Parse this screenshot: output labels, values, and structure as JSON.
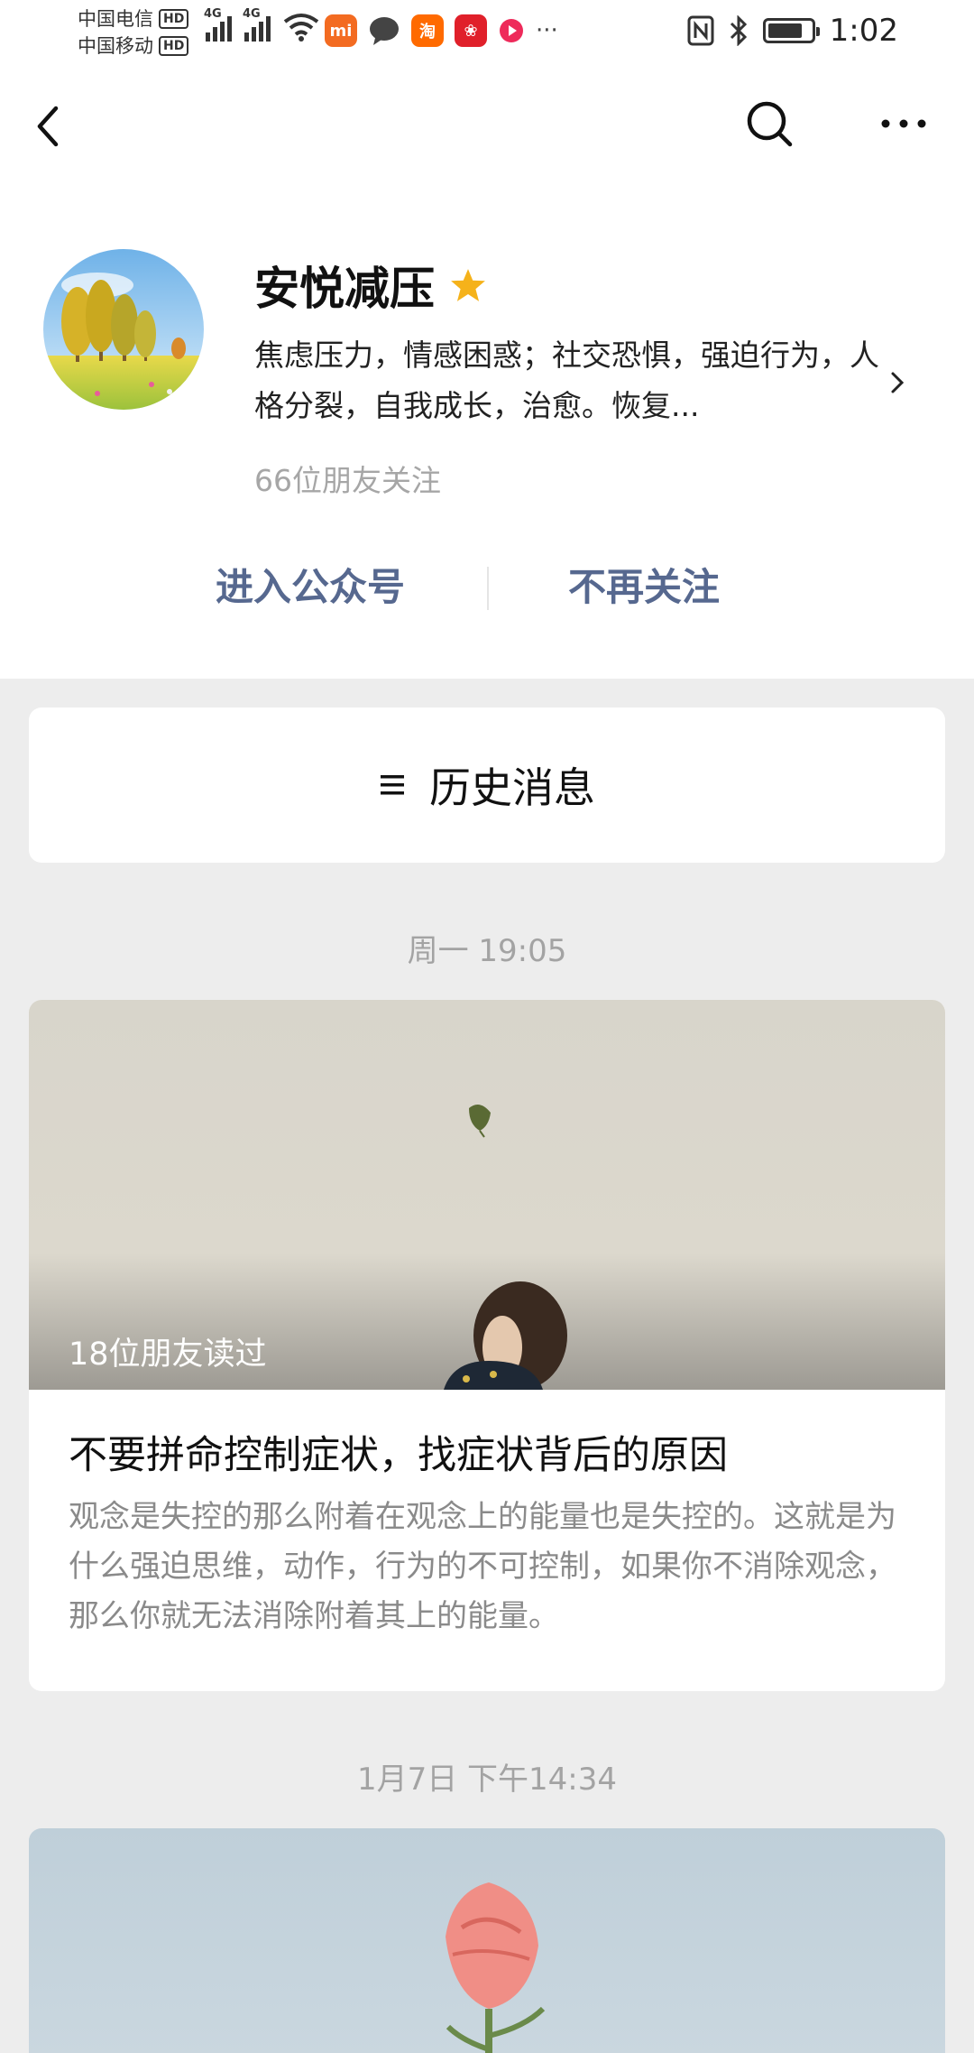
{
  "status_bar": {
    "carrier1": "中国电信",
    "carrier2": "中国移动",
    "hd": "HD",
    "network": "4G",
    "app_icon_text": [
      "淘"
    ],
    "more": "···",
    "time": "1:02"
  },
  "profile": {
    "name": "安悦减压",
    "description": "焦虑压力，情感困惑；社交恐惧，强迫行为，人格分裂，自我成长，治愈。恢复...",
    "followers": "66位朋友关注",
    "enter_label": "进入公众号",
    "unfollow_label": "不再关注"
  },
  "history": {
    "label": "历史消息"
  },
  "messages": [
    {
      "time": "周一 19:05",
      "read_count": "18位朋友读过",
      "title": "不要拼命控制症状，找症状背后的原因",
      "summary": "观念是失控的那么附着在观念上的能量也是失控的。这就是为什么强迫思维，动作，行为的不可控制，如果你不消除观念，那么你就无法消除附着其上的能量。"
    },
    {
      "time": "1月7日 下午14:34"
    }
  ],
  "colors": {
    "link": "#56688f",
    "star": "#f5b21a",
    "background": "#ededed"
  }
}
